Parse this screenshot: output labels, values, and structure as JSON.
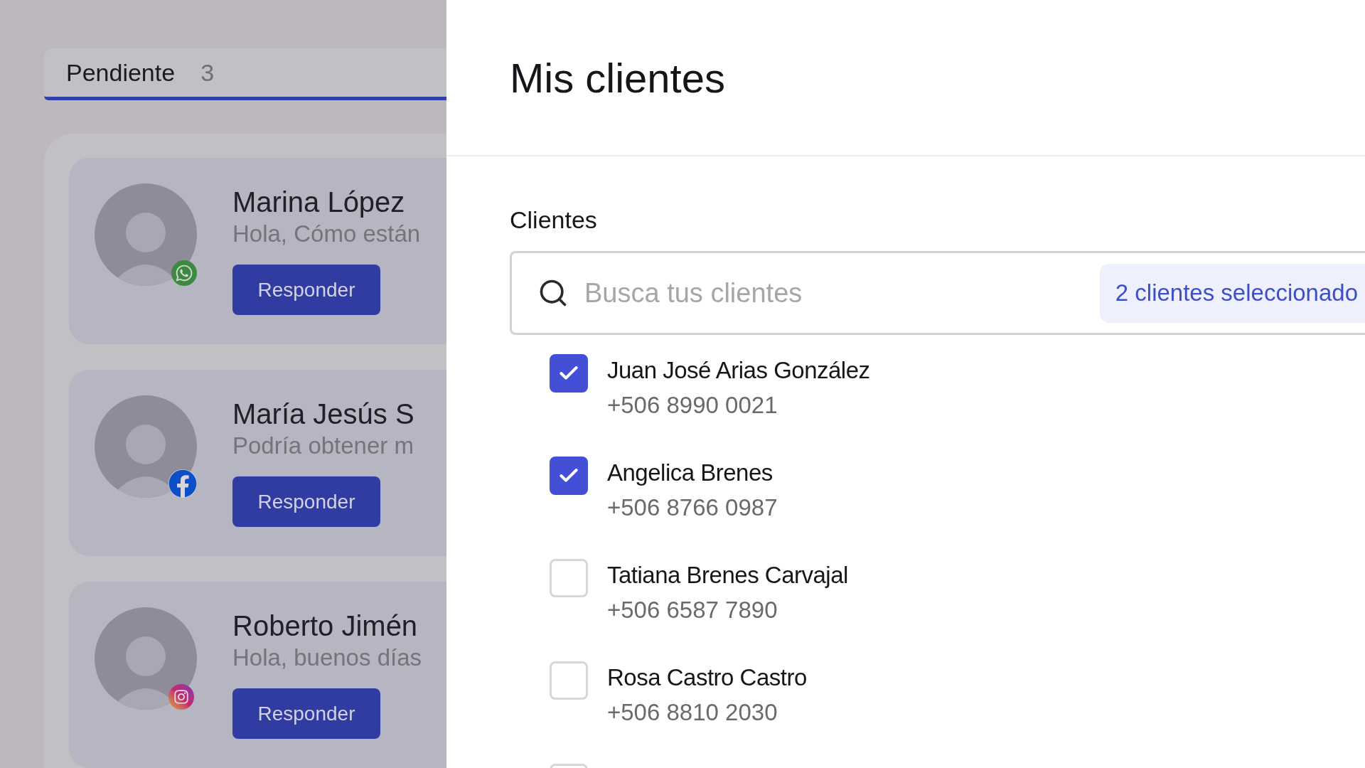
{
  "pending_tab": {
    "label": "Pendiente",
    "count": "3",
    "selected": true
  },
  "conversations": [
    {
      "name": "Marina López",
      "message": "Hola, Cómo están",
      "button": "Responder",
      "kind": "whatsapp"
    },
    {
      "name": "María Jesús S",
      "message": "Podría obtener m",
      "button": "Responder",
      "kind": "facebook"
    },
    {
      "name": "Roberto Jimén",
      "message": "Hola, buenos días",
      "button": "Responder",
      "kind": "instagram"
    }
  ],
  "panel": {
    "title": "Mis clientes",
    "section_label": "Clientes",
    "search": {
      "placeholder": "Busca tus clientes"
    },
    "selected_badge": "2 clientes seleccionado",
    "clients": [
      {
        "name": "Juan José Arias González",
        "phone": "+506 8990 0021",
        "checked": true
      },
      {
        "name": "Angelica Brenes",
        "phone": "+506 8766 0987",
        "checked": true
      },
      {
        "name": "Tatiana Brenes Carvajal",
        "phone": "+506 6587 7890",
        "checked": false
      },
      {
        "name": "Rosa Castro Castro",
        "phone": "+506 8810 2030",
        "checked": false
      },
      {
        "checked": false
      }
    ]
  }
}
